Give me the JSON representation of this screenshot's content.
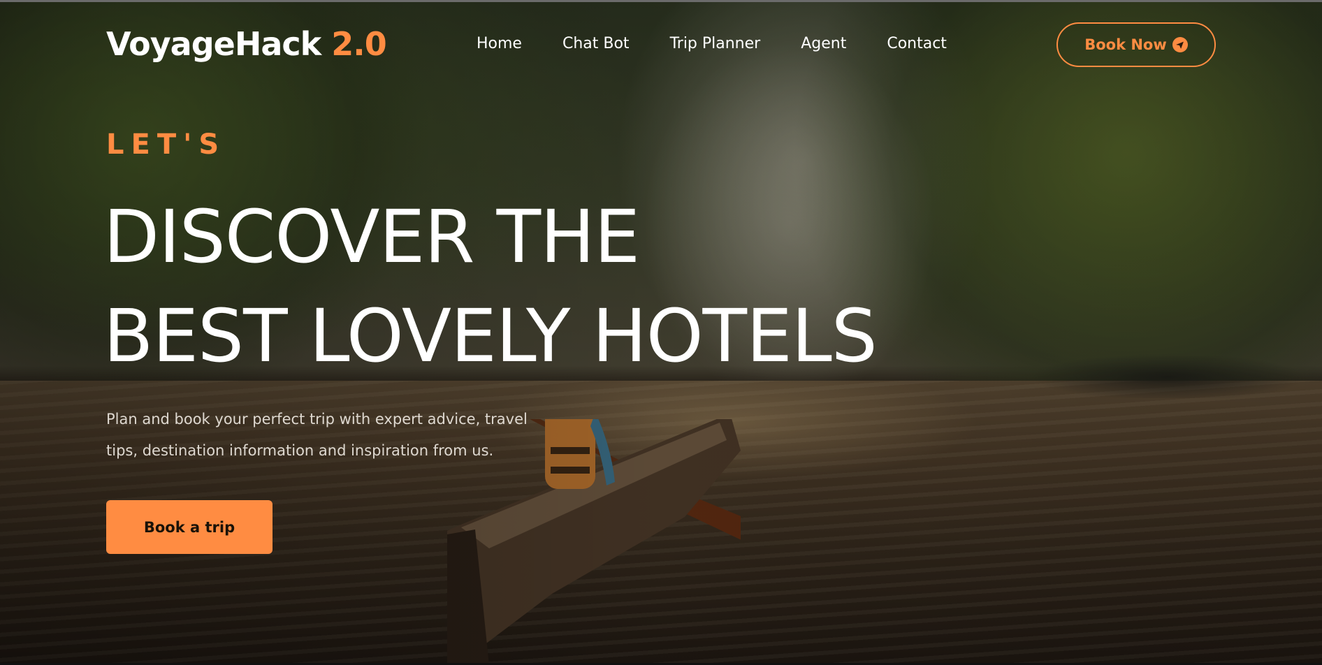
{
  "nav": {
    "logo_main": "VoyageHack",
    "logo_accent": "2.0",
    "items": [
      {
        "label": "Home"
      },
      {
        "label": "Chat Bot"
      },
      {
        "label": "Trip Planner"
      },
      {
        "label": "Agent"
      },
      {
        "label": "Contact"
      }
    ],
    "cta_label": "Book Now",
    "cta_icon": "send-icon"
  },
  "hero": {
    "eyebrow": "LET'S",
    "headline_line1": "DISCOVER THE",
    "headline_line2": "BEST LOVELY HOTELS",
    "subtitle": "Plan and book your perfect trip with expert advice, travel tips, destination information and inspiration from us.",
    "cta_label": "Book a trip",
    "background_image": "woman-paddling-canoe-river-canyon"
  },
  "colors": {
    "accent": "#ff8c42",
    "text": "#ffffff",
    "button_text": "#1a1208"
  }
}
